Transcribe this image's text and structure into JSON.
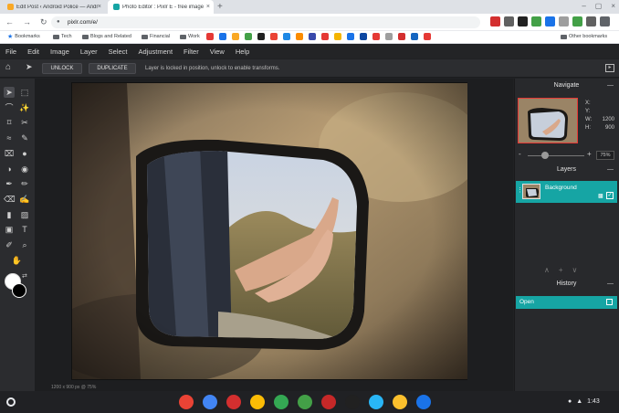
{
  "browser": {
    "tabs": [
      {
        "title": "Edit Post ‹ Android Police — Andr",
        "favicon_color": "#f9a825"
      },
      {
        "title": "Photo Editor : Pixlr E - free image",
        "favicon_color": "#16a5a4"
      }
    ],
    "new_tab_glyph": "+",
    "close_glyph": "×",
    "window_controls": [
      "–",
      "▢",
      "×"
    ],
    "nav_glyphs": [
      "←",
      "→",
      "↻"
    ],
    "url": "pixlr.com/e/",
    "bookmarks": {
      "label": "Bookmarks",
      "folders": [
        "Tech",
        "Blogs and Related",
        "Financial",
        "Work"
      ],
      "other": "Other bookmarks",
      "icon_colors": [
        "#e53935",
        "#1a73e8",
        "#f9a825",
        "#43a047",
        "#212121",
        "#ea4335",
        "#1e88e5",
        "#fb8c00",
        "#3949ab",
        "#e53935",
        "#f4b400",
        "#1a73e8",
        "#0d47a1",
        "#e53935",
        "#9e9e9e",
        "#d32f2f",
        "#1565c0",
        "#e53935"
      ]
    },
    "extension_colors": [
      "#d32f2f",
      "#616161",
      "#212121",
      "#43a047",
      "#1a73e8",
      "#9e9e9e",
      "#43a047",
      "#616161",
      "#5f6368"
    ]
  },
  "menu": [
    "File",
    "Edit",
    "Image",
    "Layer",
    "Select",
    "Adjustment",
    "Filter",
    "View",
    "Help"
  ],
  "options": {
    "home_icon": "⌂",
    "move_icon": "➤",
    "unlock_label": "UNLOCK",
    "duplicate_label": "DUPLICATE",
    "lock_message": "Layer is locked in position, unlock to enable transforms.",
    "collapse_glyph": "▸"
  },
  "tools": [
    {
      "name": "arrange-tool-icon",
      "glyph": "➤"
    },
    {
      "name": "marquee-tool-icon",
      "glyph": "⬚"
    },
    {
      "name": "lasso-tool-icon",
      "glyph": "⌒"
    },
    {
      "name": "wand-tool-icon",
      "glyph": "✨"
    },
    {
      "name": "crop-tool-icon",
      "glyph": "⌑"
    },
    {
      "name": "cut-tool-icon",
      "glyph": "✂"
    },
    {
      "name": "liquify-tool-icon",
      "glyph": "≈"
    },
    {
      "name": "heal-tool-icon",
      "glyph": "✎"
    },
    {
      "name": "clone-tool-icon",
      "glyph": "⌧"
    },
    {
      "name": "drop-tool-icon",
      "glyph": "●"
    },
    {
      "name": "dodge-tool-icon",
      "glyph": "◑"
    },
    {
      "name": "sponge-tool-icon",
      "glyph": "◉"
    },
    {
      "name": "pen-tool-icon",
      "glyph": "✒"
    },
    {
      "name": "brush-tool-icon",
      "glyph": "✏"
    },
    {
      "name": "eraser-tool-icon",
      "glyph": "⌫"
    },
    {
      "name": "color-replace-tool-icon",
      "glyph": "✍"
    },
    {
      "name": "fill-tool-icon",
      "glyph": "▮"
    },
    {
      "name": "gradient-tool-icon",
      "glyph": "▨"
    },
    {
      "name": "shape-tool-icon",
      "glyph": "▣"
    },
    {
      "name": "text-tool-icon",
      "glyph": "T"
    },
    {
      "name": "eyedropper-tool-icon",
      "glyph": "✐"
    },
    {
      "name": "zoom-tool-icon",
      "glyph": "⌕"
    },
    {
      "name": "hand-tool-icon",
      "glyph": "✋"
    }
  ],
  "swap_glyph": "⇄",
  "colors": {
    "foreground": "#ffffff",
    "background": "#000000",
    "accent": "#16a5a4"
  },
  "status": {
    "size_info": "1200 x 900 px @ 75%"
  },
  "panels": {
    "navigate": {
      "title": "Navigate",
      "collapse": "—",
      "x_label": "X:",
      "y_label": "Y:",
      "w_label": "W:",
      "h_label": "H:",
      "x": "",
      "y": "",
      "w": "1200",
      "h": "900",
      "zoom_minus": "-",
      "zoom_plus": "+",
      "zoom": "75%",
      "zoom_level": 0.3
    },
    "layers": {
      "title": "Layers",
      "collapse": "—",
      "layer_name": "Background",
      "lock_glyph": "🔒",
      "check_glyph": "✓",
      "dots_glyph": "⋮",
      "controls": [
        "∧",
        "+",
        "∨"
      ]
    },
    "history": {
      "title": "History",
      "collapse": "—",
      "entry": "Open"
    }
  },
  "shelf": {
    "app_colors": [
      "#ea4335",
      "#4285f4",
      "#d32f2f",
      "#fbbc05",
      "#34a853",
      "#43a047",
      "#c62828",
      "#212121",
      "#29b6f6",
      "#fbc02d",
      "#1a73e8"
    ],
    "tray": {
      "status_glyph": "●",
      "wifi_glyph": "▲",
      "time": "1:43"
    }
  }
}
